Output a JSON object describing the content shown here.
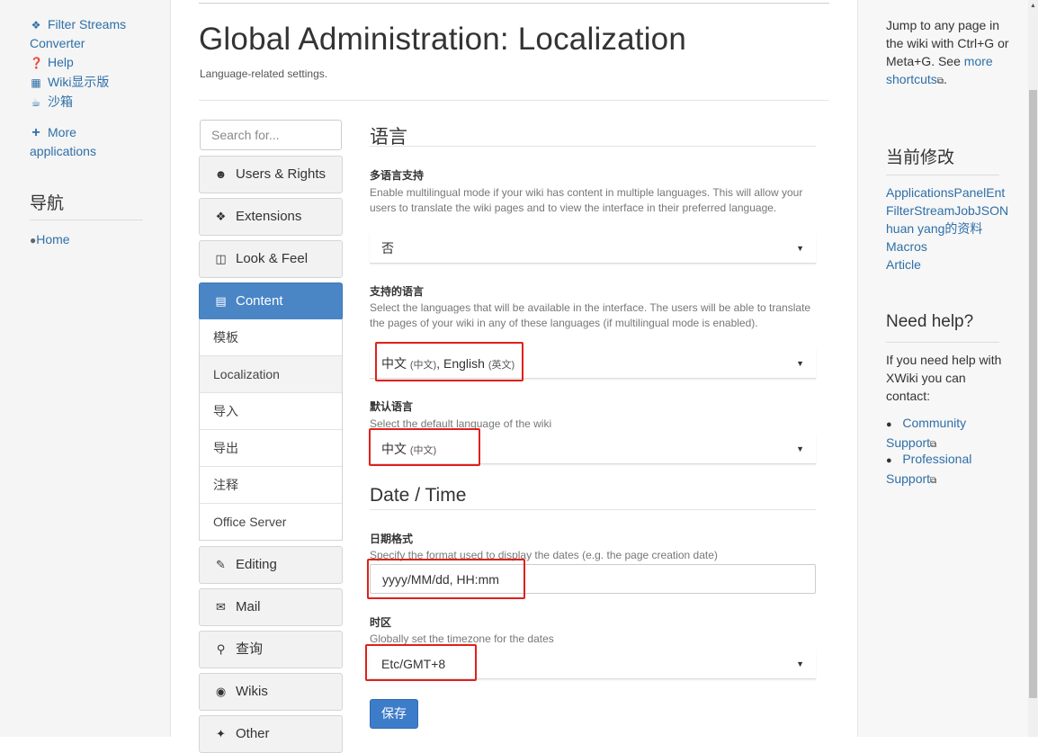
{
  "left_panel": {
    "items": [
      {
        "icon": "puzzle-icon",
        "label_line1": "Filter Streams",
        "label_line2": "Converter"
      },
      {
        "icon": "question-circle-icon",
        "label": "Help"
      },
      {
        "icon": "grid-icon",
        "label": "Wiki显示版"
      },
      {
        "icon": "coffee-icon",
        "label": "沙箱"
      },
      {
        "icon": "plus-icon",
        "label_line1": "More",
        "label_line2": "applications"
      }
    ],
    "nav_heading": "导航",
    "home_link": "Home"
  },
  "header": {
    "title": "Global Administration: Localization",
    "subtitle": "Language-related settings."
  },
  "admin_menu": {
    "search_placeholder": "Search for...",
    "items": [
      {
        "label": "Users & Rights",
        "icon": "users-icon"
      },
      {
        "label": "Extensions",
        "icon": "puzzle-icon"
      },
      {
        "label": "Look & Feel",
        "icon": "columns-icon"
      },
      {
        "label": "Content",
        "icon": "file-icon",
        "active": true
      },
      {
        "label": "Editing",
        "icon": "pencil-icon"
      },
      {
        "label": "Mail",
        "icon": "envelope-icon"
      },
      {
        "label": "查询",
        "icon": "search-icon"
      },
      {
        "label": "Wikis",
        "icon": "globe-icon"
      },
      {
        "label": "Other",
        "icon": "wrench-icon"
      }
    ],
    "content_subitems": [
      "模板",
      "Localization",
      "导入",
      "导出",
      "注释",
      "Office Server"
    ],
    "current_subitem": "Localization"
  },
  "form": {
    "language_section": "语言",
    "multilingual": {
      "label": "多语言支持",
      "hint": "Enable multilingual mode if your wiki has content in multiple languages. This will allow your users to translate the wiki pages and to view the interface in their preferred language.",
      "value": "否"
    },
    "supported_languages": {
      "label": "支持的语言",
      "hint": "Select the languages that will be available in the interface. The users will be able to translate the pages of your wiki in any of these languages (if multilingual mode is enabled).",
      "lang1": "中文",
      "lang1_native": "(中文)",
      "separator": ",",
      "lang2": "English",
      "lang2_native": "(英文)"
    },
    "default_language": {
      "label": "默认语言",
      "hint": "Select the default language of the wiki",
      "value": "中文",
      "value_native": "(中文)"
    },
    "datetime_section": "Date / Time",
    "date_format": {
      "label": "日期格式",
      "hint": "Specify the format used to display the dates (e.g. the page creation date)",
      "value": "yyyy/MM/dd, HH:mm"
    },
    "timezone": {
      "label": "时区",
      "hint": "Globally set the timezone for the dates",
      "value": "Etc/GMT+8"
    },
    "save_label": "保存"
  },
  "right_panel": {
    "shortcuts_text1": "Jump to any page in the wiki with Ctrl+G or Meta+G. See",
    "shortcuts_link": "more shortcuts",
    "shortcuts_end": ".",
    "recent_heading": "当前修改",
    "recent_items": [
      "ApplicationsPanelEnt",
      "FilterStreamJobJSON",
      "huan yang的资料",
      "Macros",
      "Article"
    ],
    "help_heading": "Need help?",
    "help_text": "If you need help with XWiki you can contact:",
    "help_links": [
      {
        "line1": "Community",
        "line2": "Support"
      },
      {
        "line1": "Professional",
        "line2": "Support"
      }
    ]
  },
  "colors": {
    "accent": "#4a86c6",
    "link": "#2f6fa8",
    "annotation_red": "#e0201b"
  }
}
